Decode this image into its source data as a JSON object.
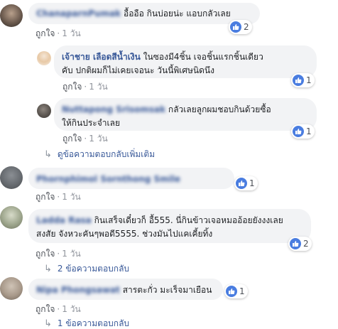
{
  "comments": [
    {
      "author_blurred": "ChanaparnPumak",
      "text": "อื้ออือ กินบ่อยน่ะ แอบกลัวเลย",
      "like_label": "ถูกใจ",
      "time": "1 วัน",
      "reactions": "2"
    },
    {
      "author": "เจ้าชาย เลือดสีน้ำเงิน",
      "text_line1": "ในซองมี4ชิ้น เจอชิ้นแรกชิ้นเดียว",
      "text_line2": "คับ ปกติผมก็ไม่เคยเจอนะ วันนี้พิเศษนิดนึง",
      "like_label": "ถูกใจ",
      "time": "1 วัน",
      "reactions": "1"
    },
    {
      "author_blurred": "Nuttapong Srisomsak",
      "text_line1": "กลัวเลยลูกผมชอบกินด้วยซื้อ",
      "text_line2": "ให้กินประจำเลย",
      "like_label": "ถูกใจ",
      "time": "1 วัน",
      "reactions": "1"
    },
    {
      "more_replies": "ดูข้อความตอบกลับเพิ่มเติม"
    },
    {
      "author_blurred": "Phornphimol Sornthong Smile",
      "like_label": "ถูกใจ",
      "time": "1 วัน",
      "reactions": "1"
    },
    {
      "author_blurred": "Ladda Rasa",
      "text_line1": "กินเสร็จเดี๋ยวก็ อื้555. นี่กินข้าวเจอหมออ้อยยังงงเลย",
      "text_line2": "สงสัย จังหวะคันๆพอดี5555. ช่วงมันไปแคเคี้ยทิ้ง",
      "reactions": "2",
      "like_label": "ถูกใจ",
      "time": "1 วัน",
      "replies": "2 ข้อความตอบกลับ"
    },
    {
      "author_blurred": "Nipa Phongsawat",
      "text": "สารตะกั่ว มะเร็จมาเยือน",
      "reactions": "1",
      "like_label": "ถูกใจ",
      "time": "1 วัน",
      "replies": "1 ข้อความตอบกลับ"
    }
  ],
  "colors": {
    "link": "#385898",
    "bubble": "#f2f3f5",
    "muted": "#90949c",
    "like": "#4a7de0"
  }
}
